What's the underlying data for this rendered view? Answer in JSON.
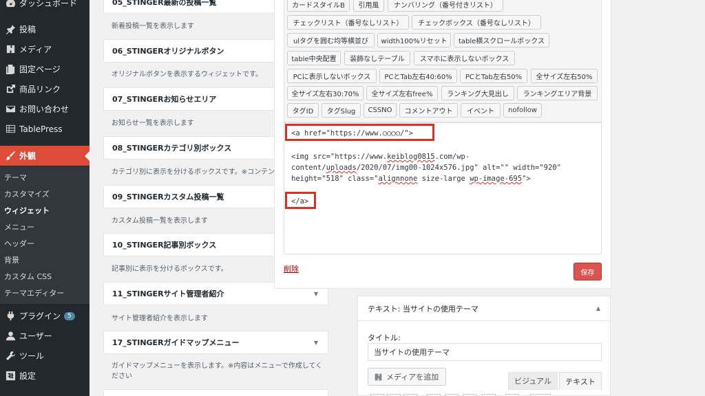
{
  "sidebar": {
    "top_item": "ダッシュボード",
    "items": [
      {
        "label": "投稿",
        "icon": "pin-icon"
      },
      {
        "label": "メディア",
        "icon": "media-icon"
      },
      {
        "label": "固定ページ",
        "icon": "page-icon"
      },
      {
        "label": "商品リンク",
        "icon": "external-link-icon"
      },
      {
        "label": "お問い合わせ",
        "icon": "envelope-icon"
      },
      {
        "label": "TablePress",
        "icon": "table-icon"
      }
    ],
    "active_item": {
      "label": "外観",
      "icon": "paintbrush-icon"
    },
    "submenu": [
      "テーマ",
      "カスタマイズ",
      "ウィジェット",
      "メニュー",
      "ヘッダー",
      "背景",
      "カスタム CSS",
      "テーマエディター"
    ],
    "submenu_current": "ウィジェット",
    "bottom_items": [
      {
        "label": "プラグイン",
        "icon": "plugin-icon",
        "badge": "5"
      },
      {
        "label": "ユーザー",
        "icon": "user-icon"
      },
      {
        "label": "ツール",
        "icon": "wrench-icon"
      },
      {
        "label": "設定",
        "icon": "settings-icon"
      }
    ]
  },
  "widgets": [
    {
      "title": "05_STINGER最新の投稿一覧",
      "desc": "新着投稿一覧を表示します"
    },
    {
      "title": "06_STINGERオリジナルボタン",
      "desc": "オリジナルボタンを表示するウィジェットです。"
    },
    {
      "title": "07_STINGERお知らせエリア",
      "desc": "お知らせ一覧を表示します"
    },
    {
      "title": "08_STINGERカテゴリ別ボックス",
      "desc": "カテゴリ別に表示を分けるボックスです。※コンテン"
    },
    {
      "title": "09_STINGERカスタム投稿一覧",
      "desc": "カスタム投稿一覧を表示します"
    },
    {
      "title": "10_STINGER記事別ボックス",
      "desc": "記事別に表示を分けるボックスです。"
    },
    {
      "title": "11_STINGERサイト管理者紹介",
      "desc": "サイト管理者紹介を表示します"
    },
    {
      "title": "17_STINGERガイドマップメニュー",
      "desc": "ガイドマップメニューを表示します。※内容はメニューで作成してください"
    }
  ],
  "quicktags": [
    [
      "カードスタイルB",
      "引用風",
      "ナンバリング（番号付きリスト）"
    ],
    [
      "チェックリスト（番号なしリスト）",
      "チェックボックス（番号なしリスト）"
    ],
    [
      "ulタグを囲む均等横並び",
      "width100%リセット",
      "table横スクロールボックス"
    ],
    [
      "table中央配置",
      "装飾なしテーブル",
      "スマホに表示しないボックス"
    ],
    [
      "PCに表示しないボックス",
      "PCとTab左右40:60%",
      "PCとTab左右50%",
      "全サイズ左右50%"
    ],
    [
      "全サイズ左右30:70%",
      "全サイズ左右free%",
      "ランキング大見出し",
      "ランキングエリア背景"
    ],
    [
      "タグID",
      "タグSlug",
      "CSSNO",
      "コメントアウト",
      "イベント",
      "nofollow"
    ]
  ],
  "editor": {
    "line1": "<a href=\"https://www.○○○○/\">",
    "img_l1_a": "<img src=\"https://www.",
    "img_l1_b": "keiblog0815",
    "img_l1_c": ".com/wp-",
    "img_l2_a": "content/",
    "img_l2_b": "uploads",
    "img_l2_c": "/2020/07/img00-1024x576.jpg\" alt=\"\" width=\"920\"",
    "img_l3_a": "height=\"518\" class=\"",
    "img_l3_b": "alignnone",
    "img_l3_c": " size-large ",
    "img_l3_d": "wp-image-695",
    "img_l3_e": "\">",
    "line_close": "</a>",
    "delete_label": "削除",
    "save_label": "保存"
  },
  "text_widget": {
    "head": "テキスト: 当サイトの使用テーマ",
    "title_label": "タイトル:",
    "title_value": "当サイトの使用テーマ",
    "add_media": "メディアを追加",
    "tab_visual": "ビジュアル",
    "tab_text": "テキスト"
  },
  "colors": {
    "sidebar_bg": "#23282d",
    "active": "#dd4b39",
    "save": "#d9534f",
    "highlight_box": "#d93025"
  }
}
